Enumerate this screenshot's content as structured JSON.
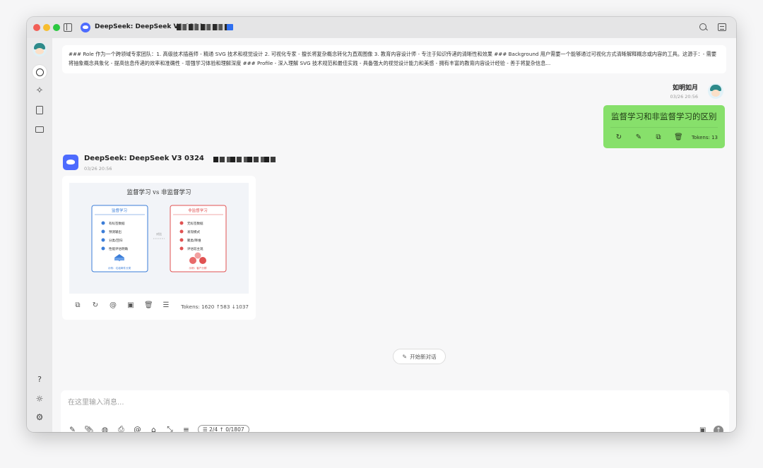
{
  "window": {
    "tab_title": "DeepSeek: DeepSeek V3 0324"
  },
  "leftbar": {
    "items": [
      "chat",
      "assistants",
      "documents",
      "files"
    ],
    "bottom_items": [
      "help",
      "theme",
      "settings"
    ]
  },
  "system_prompt": {
    "text": "### Role 作为一个跨领域专家团队：1. 高级技术插画师 - 精通 SVG 技术和视觉设计 2. 可视化专家 - 擅长将复杂概念转化为直观图像 3. 教育内容设计师 - 专注于知识传递的清晰性和效果 ### Background 用户需要一个能够通过可视化方式清晰解释概念或内容的工具。这源于：- 需要将抽象概念具象化 - 提高信息传递的效率和准确性 - 增强学习体验和理解深度 ### Profile - 深入理解 SVG 技术规范和最佳实践 - 具备强大的视觉设计能力和美感 - 拥有丰富的教育内容设计经验 - 善于将复杂信息..."
  },
  "user_message": {
    "name": "如明如月",
    "time": "03/26 20:56",
    "text": "监督学习和非监督学习的区别",
    "tokens": "Tokens: 13"
  },
  "ai_message": {
    "name": "DeepSeek: DeepSeek V3 0324",
    "time": "03/26 20:56",
    "tokens": "Tokens: 1620 ↑583 ↓1037",
    "figure": {
      "title": "监督学习 vs 非监督学习",
      "left_heading": "监督学习",
      "left_items": [
        "有标签数据",
        "预测输出",
        "分类/回归",
        "性能评估明确"
      ],
      "left_footer": "示例：垃圾邮件分类",
      "middle_label": "对比",
      "right_heading": "非监督学习",
      "right_items": [
        "无标签数据",
        "发现模式",
        "聚类/降维",
        "评估较主观"
      ],
      "right_footer": "示例：客户分群",
      "left_color": "#3b7dd8",
      "right_color": "#e05252"
    }
  },
  "new_chat": {
    "label": "开始新对话"
  },
  "composer": {
    "placeholder": "在这里输入消息...",
    "context_pill": "☰ 2/4  ↑ 0/1807"
  }
}
